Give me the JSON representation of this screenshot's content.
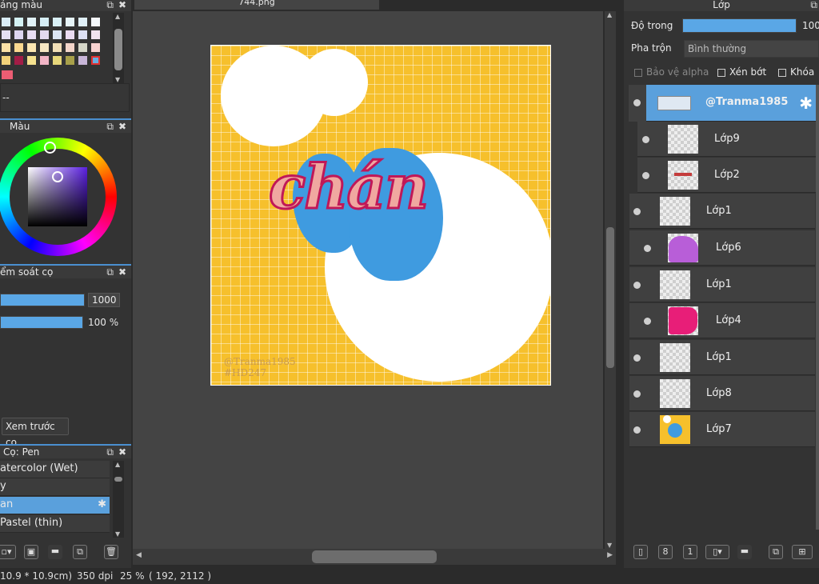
{
  "palette_panel": {
    "title": "ảng màu",
    "value": "--"
  },
  "color_panel": {
    "title": "Màu"
  },
  "brush_control": {
    "title": "ểm soát cọ",
    "size_value": "1000",
    "opacity_value": "100 %",
    "preview_button": "Xem trước cọ"
  },
  "brush_panel": {
    "title": "Cọ: Pen",
    "items": [
      "atercolor (Wet)",
      "y",
      "an",
      "Pastel (thin)"
    ]
  },
  "canvas": {
    "tab_title": "744.png",
    "watermark_line1": "@Tranma1985",
    "watermark_line2": "#HD247",
    "art_text": "chán"
  },
  "status_bar": {
    "size": "10.9 * 10.9cm)",
    "dpi": "350 dpi",
    "zoom": "25 %",
    "coords": "( 192, 2112 )"
  },
  "layers_panel": {
    "title": "Lớp",
    "opacity_label": "Độ trong",
    "opacity_value": "100",
    "blend_label": "Pha trộn",
    "blend_value": "Bình thường",
    "protect_alpha": "Bảo vệ alpha",
    "clipping": "Xén bớt",
    "lock": "Khóa",
    "layers": [
      {
        "name": "@Tranma1985"
      },
      {
        "name": "Lớp9"
      },
      {
        "name": "Lớp2"
      },
      {
        "name": "Lớp1"
      },
      {
        "name": "Lớp6"
      },
      {
        "name": "Lớp1"
      },
      {
        "name": "Lớp4"
      },
      {
        "name": "Lớp1"
      },
      {
        "name": "Lớp8"
      },
      {
        "name": "Lớp7"
      }
    ]
  },
  "colors": {
    "accent": "#5aa7e6",
    "canvas_bg": "#f5c230",
    "blob": "#3f9be0",
    "panel": "#333333"
  },
  "icons": [
    "gear-icon",
    "popout-icon",
    "close-icon",
    "new-layer-icon",
    "folder-icon",
    "trash-icon",
    "duplicate-icon"
  ]
}
